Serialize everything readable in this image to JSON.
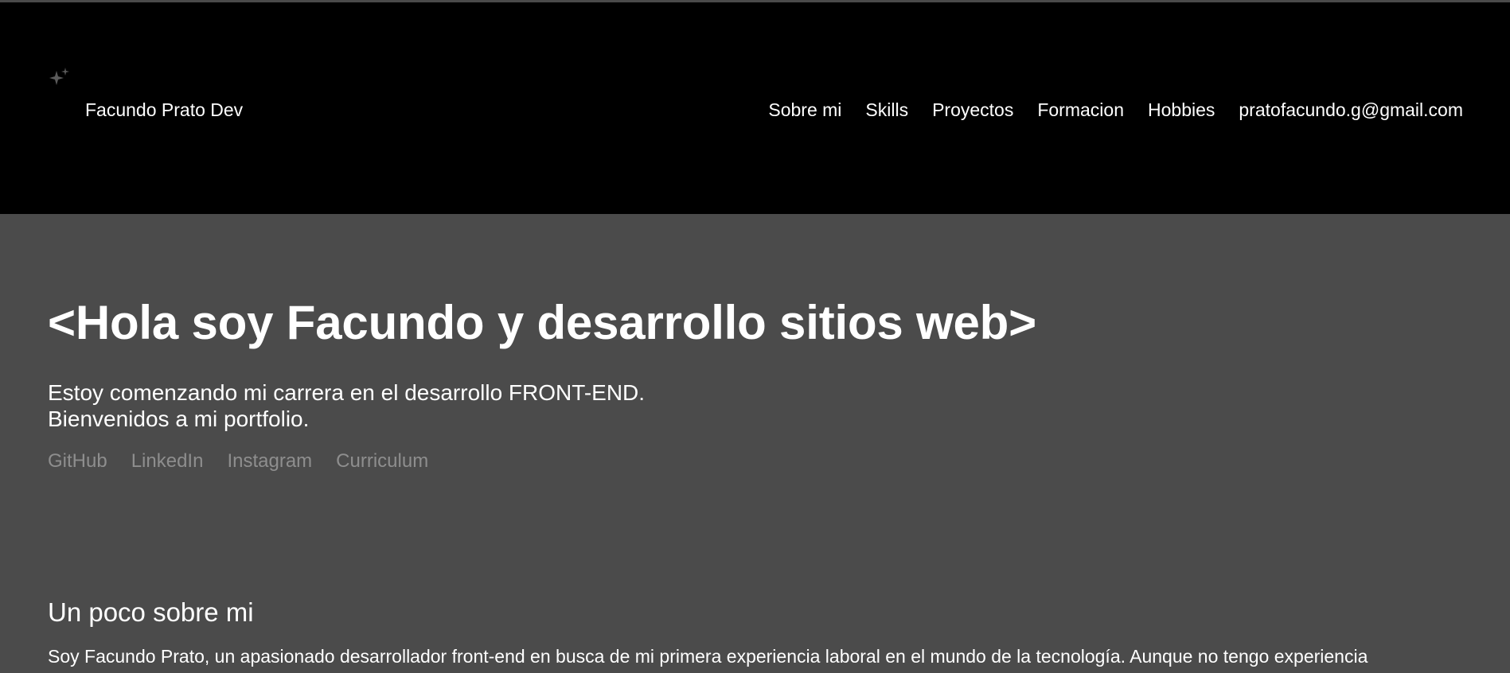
{
  "header": {
    "brand_name": "Facundo Prato Dev",
    "brand_icon": "sparkles-icon",
    "nav": [
      {
        "label": "Sobre mi"
      },
      {
        "label": "Skills"
      },
      {
        "label": "Proyectos"
      },
      {
        "label": "Formacion"
      },
      {
        "label": "Hobbies"
      },
      {
        "label": "pratofacundo.g@gmail.com"
      }
    ]
  },
  "hero": {
    "title": "<Hola soy Facundo y desarrollo sitios web>",
    "subtitle_line1": "Estoy comenzando mi carrera en el desarrollo FRONT-END.",
    "subtitle_line2": "Bienvenidos a mi portfolio.",
    "social_links": [
      {
        "label": "GitHub"
      },
      {
        "label": "LinkedIn"
      },
      {
        "label": "Instagram"
      },
      {
        "label": "Curriculum"
      }
    ]
  },
  "about": {
    "title": "Un poco sobre mi",
    "text": "Soy Facundo Prato, un apasionado desarrollador front-end en busca de mi primera experiencia laboral en el mundo de la tecnología. Aunque no tengo experiencia"
  },
  "colors": {
    "header_bg": "#000000",
    "page_bg": "#4b4b4b",
    "text": "#ffffff",
    "muted_link": "#8e8e8e"
  }
}
